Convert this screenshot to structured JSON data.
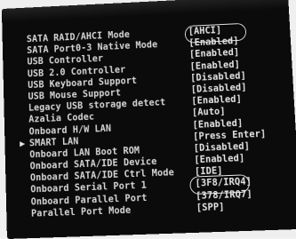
{
  "bios": {
    "top_faint_text": "",
    "settings": [
      {
        "label": "SATA RAID/AHCI Mode",
        "value": "[AHCI]"
      },
      {
        "label": "SATA Port0-3 Native Mode",
        "value": "[Enabled]"
      },
      {
        "label": "USB Controller",
        "value": "[Enabled]"
      },
      {
        "label": "USB 2.0 Controller",
        "value": "[Enabled]"
      },
      {
        "label": "USB Keyboard Support",
        "value": "[Disabled]"
      },
      {
        "label": "USB Mouse Support",
        "value": "[Disabled]"
      },
      {
        "label": "Legacy USB storage detect",
        "value": "[Enabled]"
      },
      {
        "label": "Azalia Codec",
        "value": "[Auto]"
      },
      {
        "label": "Onboard H/W LAN",
        "value": "[Enabled]"
      },
      {
        "label": "SMART LAN",
        "value": "[Press Enter]",
        "submenu": true
      },
      {
        "label": "Onboard LAN Boot ROM",
        "value": "[Disabled]"
      },
      {
        "label": "Onboard SATA/IDE Device",
        "value": "[Enabled]"
      },
      {
        "label": "Onboard SATA/IDE Ctrl Mode",
        "value": "[IDE]"
      },
      {
        "label": "Onboard Serial Port 1",
        "value": "[3F8/IRQ4]"
      },
      {
        "label": "Onboard Parallel Port",
        "value": "[378/IRQ7]"
      },
      {
        "label": "Parallel Port Mode",
        "value": "[SPP]"
      }
    ]
  },
  "colors": {
    "screen_background": "#0b0b0b",
    "text": "#d7d7d7"
  }
}
